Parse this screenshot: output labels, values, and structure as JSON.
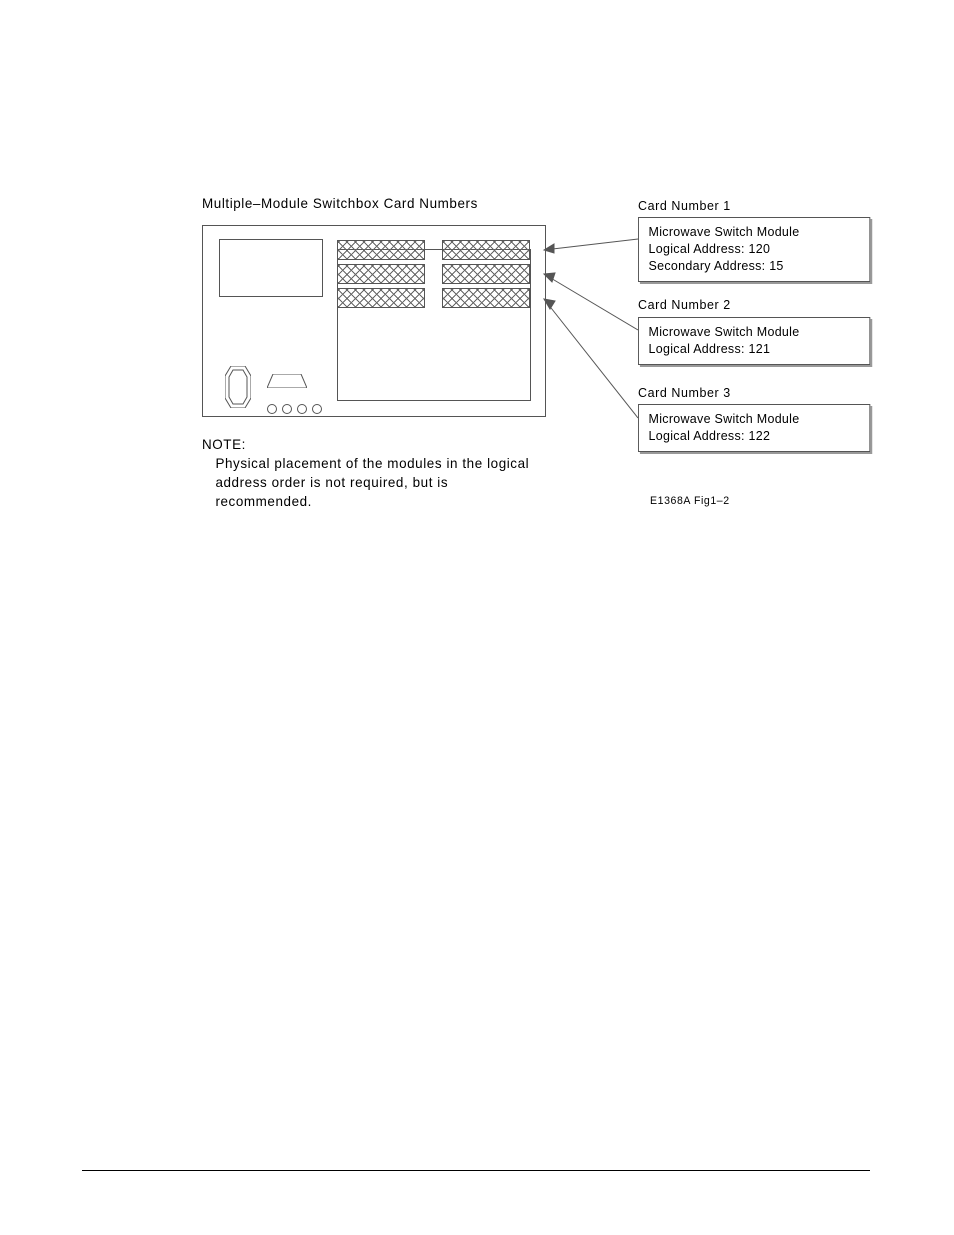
{
  "figure": {
    "title": "Multiple–Module Switchbox Card Numbers",
    "cards": [
      {
        "label": "Card Number 1",
        "line1": "Microwave Switch Module",
        "line2": "Logical Address: 120",
        "line3": "Secondary Address: 15"
      },
      {
        "label": "Card Number 2",
        "line1": "Microwave Switch Module",
        "line2": "Logical Address: 121"
      },
      {
        "label": "Card Number 3",
        "line1": "Microwave Switch Module",
        "line2": "Logical Address: 122"
      }
    ],
    "note": {
      "heading": "NOTE:",
      "body": "Physical placement of the modules in the logical address order is not required, but is recommended."
    },
    "ref": "E1368A Fig1–2"
  }
}
